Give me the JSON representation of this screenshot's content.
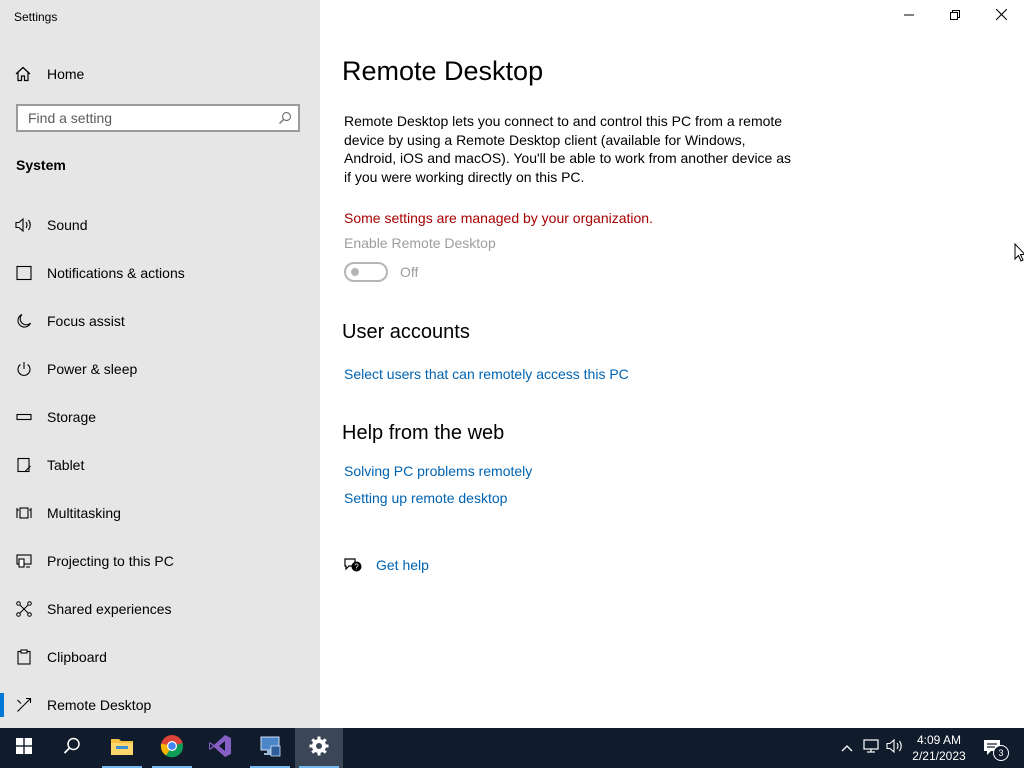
{
  "window": {
    "title": "Settings"
  },
  "sidebar": {
    "home_label": "Home",
    "search_placeholder": "Find a setting",
    "section_label": "System",
    "items": [
      {
        "label": "Sound",
        "icon": "speaker-icon"
      },
      {
        "label": "Notifications & actions",
        "icon": "notification-icon"
      },
      {
        "label": "Focus assist",
        "icon": "moon-icon"
      },
      {
        "label": "Power & sleep",
        "icon": "power-icon"
      },
      {
        "label": "Storage",
        "icon": "storage-icon"
      },
      {
        "label": "Tablet",
        "icon": "tablet-icon"
      },
      {
        "label": "Multitasking",
        "icon": "multitasking-icon"
      },
      {
        "label": "Projecting to this PC",
        "icon": "projecting-icon"
      },
      {
        "label": "Shared experiences",
        "icon": "shared-experiences-icon"
      },
      {
        "label": "Clipboard",
        "icon": "clipboard-icon"
      },
      {
        "label": "Remote Desktop",
        "icon": "remote-desktop-icon",
        "selected": true
      }
    ]
  },
  "main": {
    "title": "Remote Desktop",
    "description": "Remote Desktop lets you connect to and control this PC from a remote device by using a Remote Desktop client (available for Windows, Android, iOS and macOS). You'll be able to work from another device as if you were working directly on this PC.",
    "managed_warning": "Some settings are managed by your organization.",
    "toggle_label": "Enable Remote Desktop",
    "toggle_state": "Off",
    "user_accounts_heading": "User accounts",
    "select_users_link": "Select users that can remotely access this PC",
    "help_heading": "Help from the web",
    "help_links": [
      "Solving PC problems remotely",
      "Setting up remote desktop"
    ],
    "get_help": "Get help"
  },
  "taskbar": {
    "time": "4:09 AM",
    "date": "2/21/2023",
    "notification_count": "3",
    "apps": [
      "start-icon",
      "search-icon",
      "file-explorer-icon",
      "chrome-icon",
      "visual-studio-icon",
      "server-manager-icon",
      "settings-gear-icon"
    ]
  },
  "colors": {
    "sidebar_bg": "#e6e6e6",
    "accent": "#0078d7",
    "link": "#0063b1",
    "warning": "#a80000",
    "taskbar_bg": "#101b2b"
  }
}
